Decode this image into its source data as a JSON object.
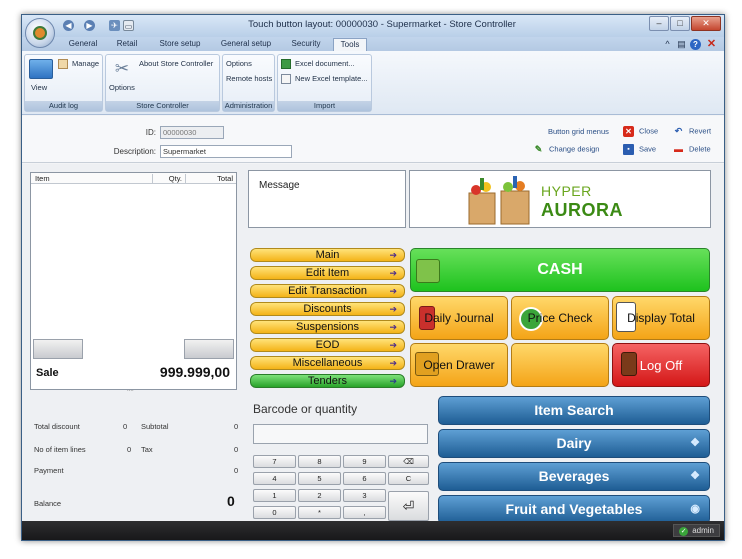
{
  "window": {
    "title": "Touch button layout: 00000030 - Supermarket - Store Controller"
  },
  "ribbon": {
    "tabs": [
      "General",
      "Retail",
      "Store setup",
      "General setup",
      "Security",
      "Tools"
    ],
    "active_tab": "Tools",
    "groups": {
      "audit_log": {
        "label": "Audit log",
        "view": "View",
        "manage": "Manage"
      },
      "store_controller": {
        "label": "Store Controller",
        "options": "Options",
        "about": "About Store Controller"
      },
      "administration": {
        "label": "Administration",
        "options": "Options",
        "remote_hosts": "Remote hosts"
      },
      "import": {
        "label": "Import",
        "excel_document": "Excel document...",
        "new_excel_template": "New Excel template..."
      }
    }
  },
  "header": {
    "id_label": "ID:",
    "id_value": "00000030",
    "description_label": "Description:",
    "description_value": "Supermarket",
    "actions": {
      "button_grid_menus": "Button grid menus",
      "change_design": "Change design",
      "close": "Close",
      "save": "Save",
      "revert": "Revert",
      "delete": "Delete"
    }
  },
  "receipt": {
    "columns": {
      "item": "Item",
      "qty": "Qty.",
      "total": "Total"
    },
    "sale_label": "Sale",
    "sale_amount": "999.999,00",
    "splitter": "....",
    "totals": {
      "total_discount_label": "Total discount",
      "total_discount_value": "0",
      "subtotal_label": "Subtotal",
      "subtotal_value": "0",
      "item_lines_label": "No of item lines",
      "item_lines_value": "0",
      "tax_label": "Tax",
      "tax_value": "0",
      "payment_label": "Payment",
      "payment_value": "0",
      "balance_label": "Balance",
      "balance_value": "0"
    }
  },
  "message": {
    "label": "Message"
  },
  "logo": {
    "line1": "HYPER",
    "line2": "AURORA"
  },
  "menu_buttons": [
    "Main",
    "Edit Item",
    "Edit Transaction",
    "Discounts",
    "Suspensions",
    "EOD",
    "Miscellaneous",
    "Tenders"
  ],
  "action_buttons": {
    "cash": "CASH",
    "daily_journal": "Daily Journal",
    "price_check": "Price Check",
    "display_total": "Display Total",
    "open_drawer": "Open Drawer",
    "blank": "",
    "log_off": "Log Off"
  },
  "barcode": {
    "label": "Barcode or quantity",
    "value": ""
  },
  "keypad": {
    "rows": [
      [
        "7",
        "8",
        "9",
        "⌫"
      ],
      [
        "4",
        "5",
        "6",
        "C"
      ],
      [
        "1",
        "2",
        "3"
      ],
      [
        "0",
        "*",
        ","
      ]
    ],
    "enter": "⏎"
  },
  "category_buttons": [
    {
      "label": "Item Search",
      "mark": ""
    },
    {
      "label": "Dairy",
      "mark": "❖"
    },
    {
      "label": "Beverages",
      "mark": "❖"
    },
    {
      "label": "Fruit and Vegetables",
      "mark": "◉"
    }
  ],
  "status": {
    "user": "admin"
  },
  "colors": {
    "menu_button": "#f4b317",
    "tenders_button": "#28a329",
    "cash_button": "#1ec21e",
    "log_off_button": "#d41717",
    "category_button": "#1e5d94"
  }
}
